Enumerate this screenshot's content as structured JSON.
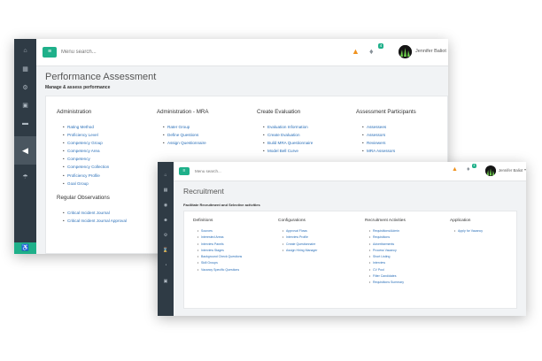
{
  "perf_window": {
    "search_placeholder": "Menu search...",
    "notification_count": "4",
    "user_name": "Jennifer Baliot",
    "page_title": "Performance Assessment",
    "page_subtitle": "Manage & assess performance",
    "sidebar_icons": [
      "home-icon",
      "dashboard-icon",
      "settings-icon",
      "briefcase-icon",
      "card-icon",
      "collapse-arrow-icon",
      "umbrella-icon",
      "accessibility-icon"
    ],
    "columns": [
      {
        "heading": "Administration",
        "links": [
          "Rating Method",
          "Proficiency Level",
          "Competency Group",
          "Competency Area",
          "Competency",
          "Competency Collection",
          "Proficiency Profile",
          "Goal Group"
        ]
      },
      {
        "heading": "Administration - MRA",
        "links": [
          "Rater Group",
          "Define Questions",
          "Assign Questionnaire"
        ]
      },
      {
        "heading": "Create Evaluation",
        "links": [
          "Evaluation Information",
          "Create Evaluation",
          "Build MRA Questionnaire",
          "Model Bell Curve"
        ]
      },
      {
        "heading": "Assessment Participants",
        "links": [
          "Assessees",
          "Assessors",
          "Reviewers",
          "MRA Assessors"
        ]
      }
    ],
    "regular_observations": {
      "heading": "Regular Observations",
      "links": [
        "Critical Incident Journal",
        "Critical Incident Journal Approval"
      ]
    }
  },
  "recruit_window": {
    "search_placeholder": "Menu search...",
    "notification_count": "4",
    "user_name": "Jennifer Baliot",
    "page_title": "Recruitment",
    "page_subtitle": "Facilitate Recruitment and Selective activities",
    "columns": [
      {
        "heading": "Definitions",
        "links": [
          "Sources",
          "Interested Areas",
          "Interview Panels",
          "Interview Stages",
          "Background Check Questions",
          "Skill Groups",
          "Vacancy Specific Questions"
        ]
      },
      {
        "heading": "Configurations",
        "links": [
          "Approval Flows",
          "Interview Profile",
          "Create Questionnaire",
          "Assign Hiring Manager"
        ]
      },
      {
        "heading": "Recruitment Activities",
        "links": [
          "Requisitions/Admin",
          "Requisitions",
          "Advertisements",
          "Process Vacancy",
          "Short Listing",
          "Interview",
          "CV Pool",
          "Filter Candidates",
          "Requisitions Summary"
        ]
      },
      {
        "heading": "Application",
        "links": [
          "Apply for Vacancy"
        ]
      }
    ]
  },
  "colors": {
    "accent": "#1fb08a",
    "sidebar": "#2f3b45",
    "link": "#2a6fb8",
    "warning": "#f0921e"
  }
}
